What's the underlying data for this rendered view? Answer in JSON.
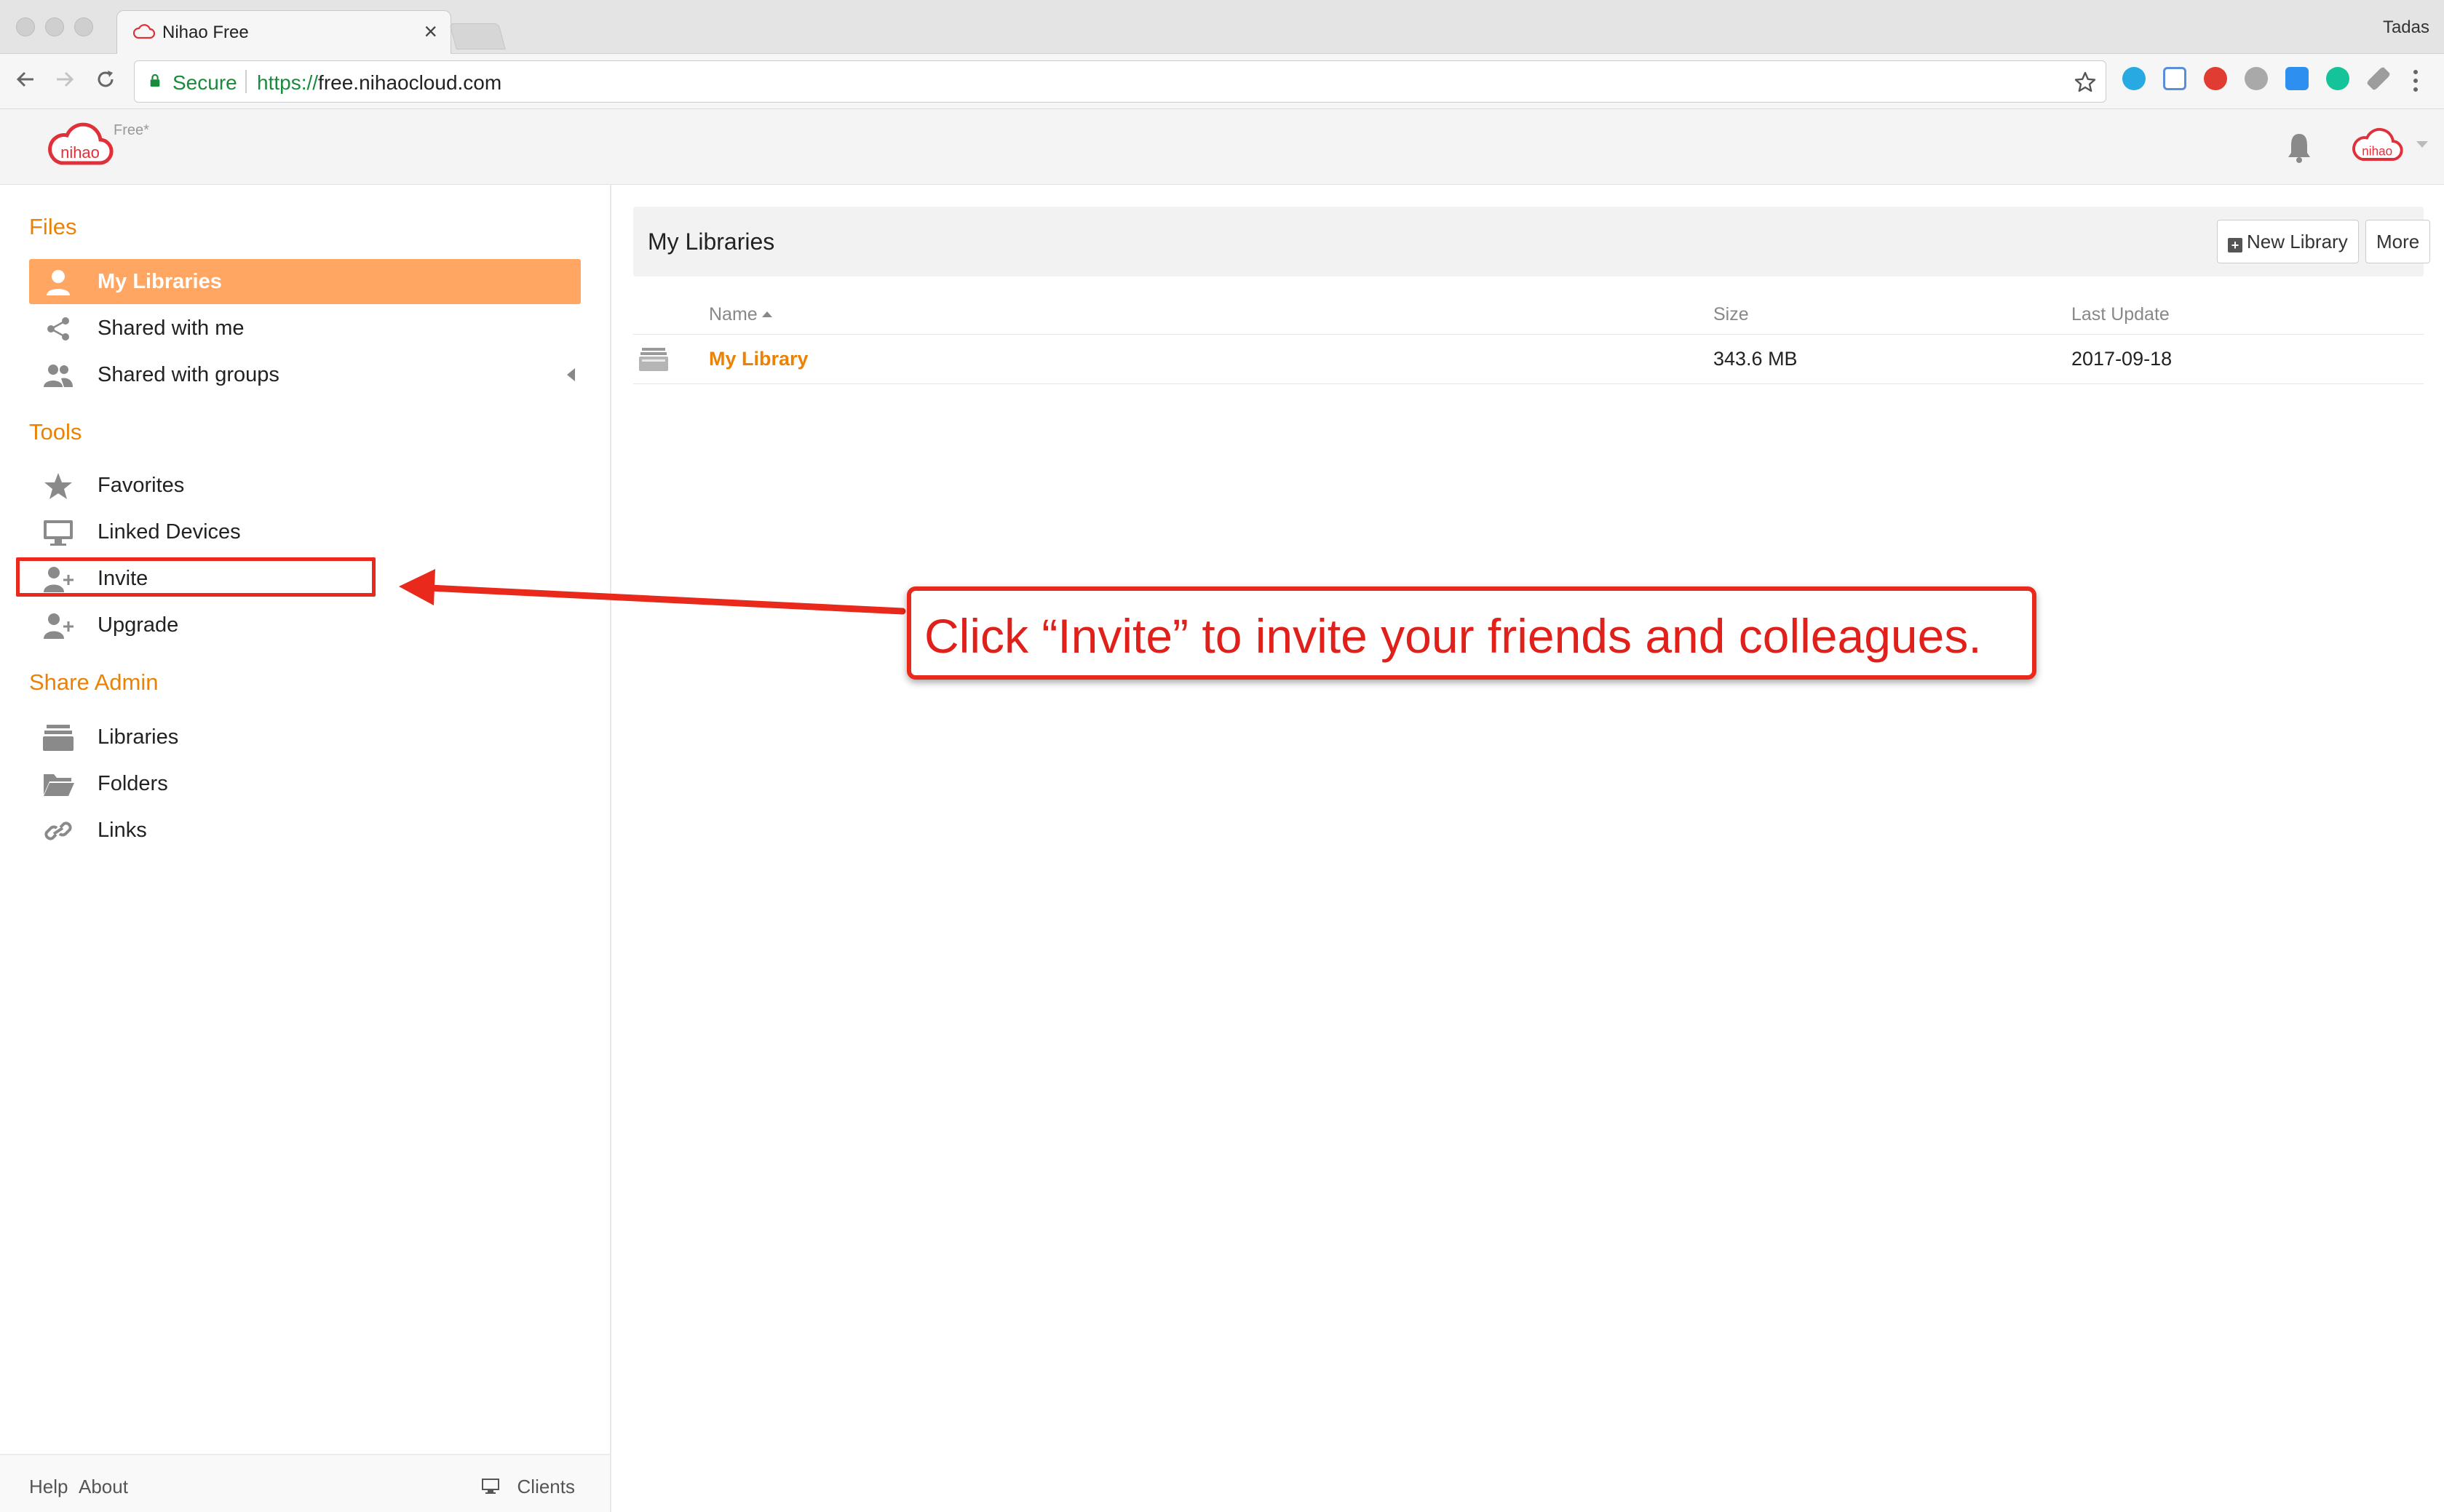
{
  "browser": {
    "tab_title": "Nihao Free",
    "tab_close": "×",
    "profile_name": "Tadas",
    "secure_label": "Secure",
    "url_scheme": "https://",
    "url_host": "free.nihaocloud.com"
  },
  "header": {
    "logo_text": "nihao",
    "plan_badge": "Free*",
    "avatar_text": "nihao"
  },
  "sidebar": {
    "files_heading": "Files",
    "files_items": [
      {
        "label": "My Libraries",
        "icon": "user-icon",
        "active": true
      },
      {
        "label": "Shared with me",
        "icon": "share-icon",
        "active": false
      },
      {
        "label": "Shared with groups",
        "icon": "group-icon",
        "active": false
      }
    ],
    "tools_heading": "Tools",
    "tools_items": [
      {
        "label": "Favorites",
        "icon": "star-icon"
      },
      {
        "label": "Linked Devices",
        "icon": "monitor-icon"
      },
      {
        "label": "Invite",
        "icon": "add-user-icon"
      },
      {
        "label": "Upgrade",
        "icon": "add-user-icon"
      }
    ],
    "admin_heading": "Share Admin",
    "admin_items": [
      {
        "label": "Libraries",
        "icon": "library-icon"
      },
      {
        "label": "Folders",
        "icon": "folder-icon"
      },
      {
        "label": "Links",
        "icon": "link-icon"
      }
    ],
    "footer": {
      "help": "Help",
      "about": "About",
      "clients": "Clients"
    }
  },
  "main": {
    "title": "My Libraries",
    "new_library_label": "New Library",
    "more_label": "More",
    "columns": {
      "name": "Name",
      "size": "Size",
      "last_update": "Last Update"
    },
    "rows": [
      {
        "name": "My Library",
        "size": "343.6 MB",
        "last_update": "2017-09-18"
      }
    ]
  },
  "annotation": {
    "callout_text": "Click “Invite” to invite your friends and colleagues.",
    "color": "#e8291c"
  },
  "colors": {
    "accent": "#eb8205",
    "active_item_bg": "#fea662"
  }
}
